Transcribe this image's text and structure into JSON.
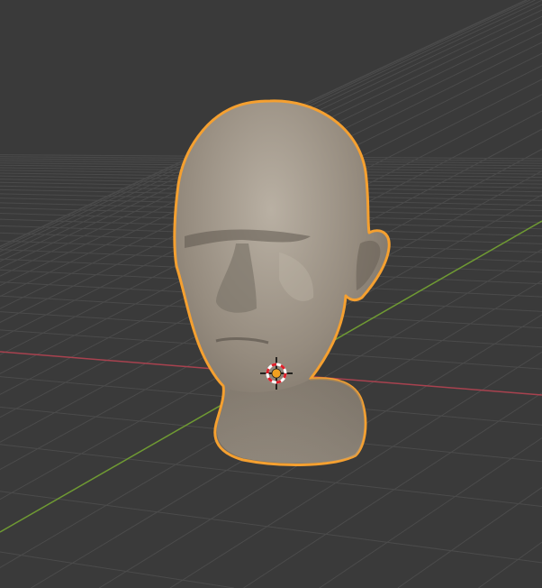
{
  "viewport": {
    "background_color": "#3a3a3a",
    "grid_color": "#4b4b4b",
    "x_axis_color": "#a8424f",
    "y_axis_color": "#6f9a33",
    "selection_outline_color": "#f5a030",
    "mesh_color": "#a49a8c",
    "object": "head-mesh",
    "cursor_icon": "3d-cursor-icon",
    "origin_icon": "object-origin-icon"
  }
}
